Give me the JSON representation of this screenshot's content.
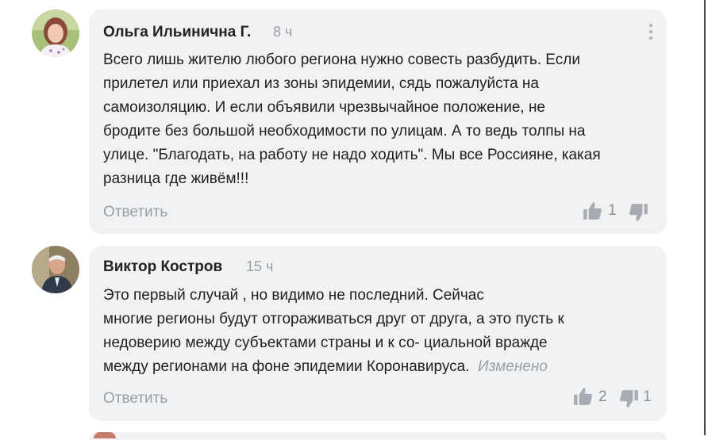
{
  "comments": [
    {
      "author": "Ольга Ильинична Г.",
      "time": "8 ч",
      "lines": [
        "Всего лишь жителю любого региона нужно совесть разбудить. Если",
        "прилетел или приехал из зоны эпидемии, сядь пожалуйста на",
        "самоизоляцию. И если объявили чрезвычайное положение, не",
        "бродите без большой необходимости по улицам. А то ведь толпы на",
        "улице. \"Благодать, на работу не надо ходить\". Мы все Россияне, какая",
        "разница где живём!!!"
      ],
      "reply_label": "Ответить",
      "likes": "1",
      "dislikes": "",
      "avatar_icon": "user-photo-icon",
      "more_icon": "more-vertical-icon"
    },
    {
      "author": "Виктор Костров",
      "time": "15 ч",
      "lines": [
        "Это  первый случай , но видимо  не последний.  Сейчас",
        "многие регионы будут отгораживаться друг от друга, а  это пусть  к",
        "недоверию между субъектами страны и к со-  циальной вражде",
        "между регионами на фоне эпидемии Коронавируса."
      ],
      "edited_label": "Изменено",
      "reply_label": "Ответить",
      "likes": "2",
      "dislikes": "1",
      "avatar_icon": "user-photo-icon"
    }
  ],
  "icons": {
    "like": "thumbs-up-icon",
    "dislike": "thumbs-down-icon"
  },
  "colors": {
    "bubble": "#f1f2f4",
    "muted_text": "#9a9ea6",
    "icon": "#a7abb2"
  }
}
